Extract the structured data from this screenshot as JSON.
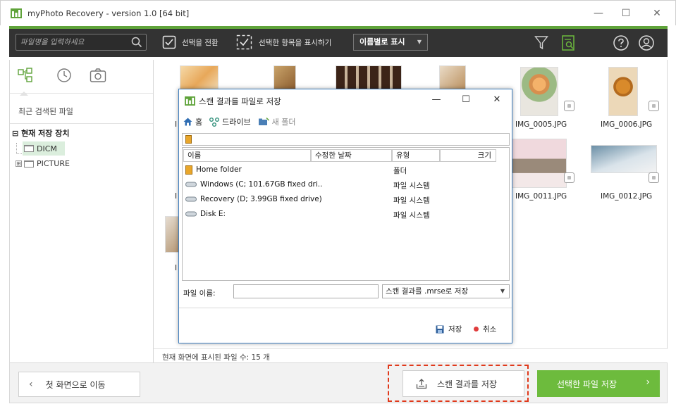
{
  "window": {
    "title": "myPhoto Recovery - version 1.0 [64 bit]",
    "controls": {
      "minimize": "—",
      "maximize": "☐",
      "close": "✕"
    }
  },
  "toolbar": {
    "search_placeholder": "파일명을 입력하세요",
    "invert_selection": "선택을 전환",
    "show_selected": "선택한 항목을 표시하기",
    "sort_by": "이름별로 표시"
  },
  "sidebar": {
    "recent_files": "최근 검색된 파일",
    "current_device": "현재 저장 장치",
    "folders": [
      "DICM",
      "PICTURE"
    ],
    "expand_symbol": "⊟",
    "collapse_symbol": "⊞"
  },
  "gallery": {
    "items": [
      {
        "label": "IMG_0005.JPG"
      },
      {
        "label": "IMG_0006.JPG"
      },
      {
        "label": "IMG_0011.JPG"
      },
      {
        "label": "IMG_0012.JPG"
      }
    ],
    "partial_labels": [
      "I",
      "I",
      "I"
    ],
    "status": "현재 화면에 표시된 파일 수: 15 개"
  },
  "bottom": {
    "back": "첫 화면으로 이동",
    "save_scan": "스캔 결과를 저장",
    "save_selected": "선택한 파일 저장",
    "chev_left": "‹",
    "chev_right": "›"
  },
  "dialog": {
    "title": "스캔 결과를 파일로 저장",
    "controls": {
      "minimize": "—",
      "maximize": "☐",
      "close": "✕"
    },
    "nav": {
      "home": "홈",
      "drive": "드라이브",
      "new_folder": "새 폴더"
    },
    "columns": [
      "이름",
      "수정한 날짜",
      "유형",
      "크기"
    ],
    "rows": [
      {
        "name": "Home folder",
        "type": "폴더",
        "kind": "folder"
      },
      {
        "name": "Windows (C; 101.67GB fixed dri..",
        "type": "파일 시스템",
        "kind": "drive"
      },
      {
        "name": "Recovery (D; 3.99GB fixed drive)",
        "type": "파일 시스템",
        "kind": "drive"
      },
      {
        "name": "Disk E:",
        "type": "파일 시스템",
        "kind": "drive"
      }
    ],
    "filename_label": "파일 이름:",
    "filename_value": "",
    "format": "스캔 결과를 .mrse로 저장",
    "save": "저장",
    "cancel": "취소"
  },
  "colors": {
    "accent": "#6dbb3d",
    "toolbar": "#333333",
    "highlight": "#e0391b",
    "dialog_border": "#3f7fbf"
  }
}
